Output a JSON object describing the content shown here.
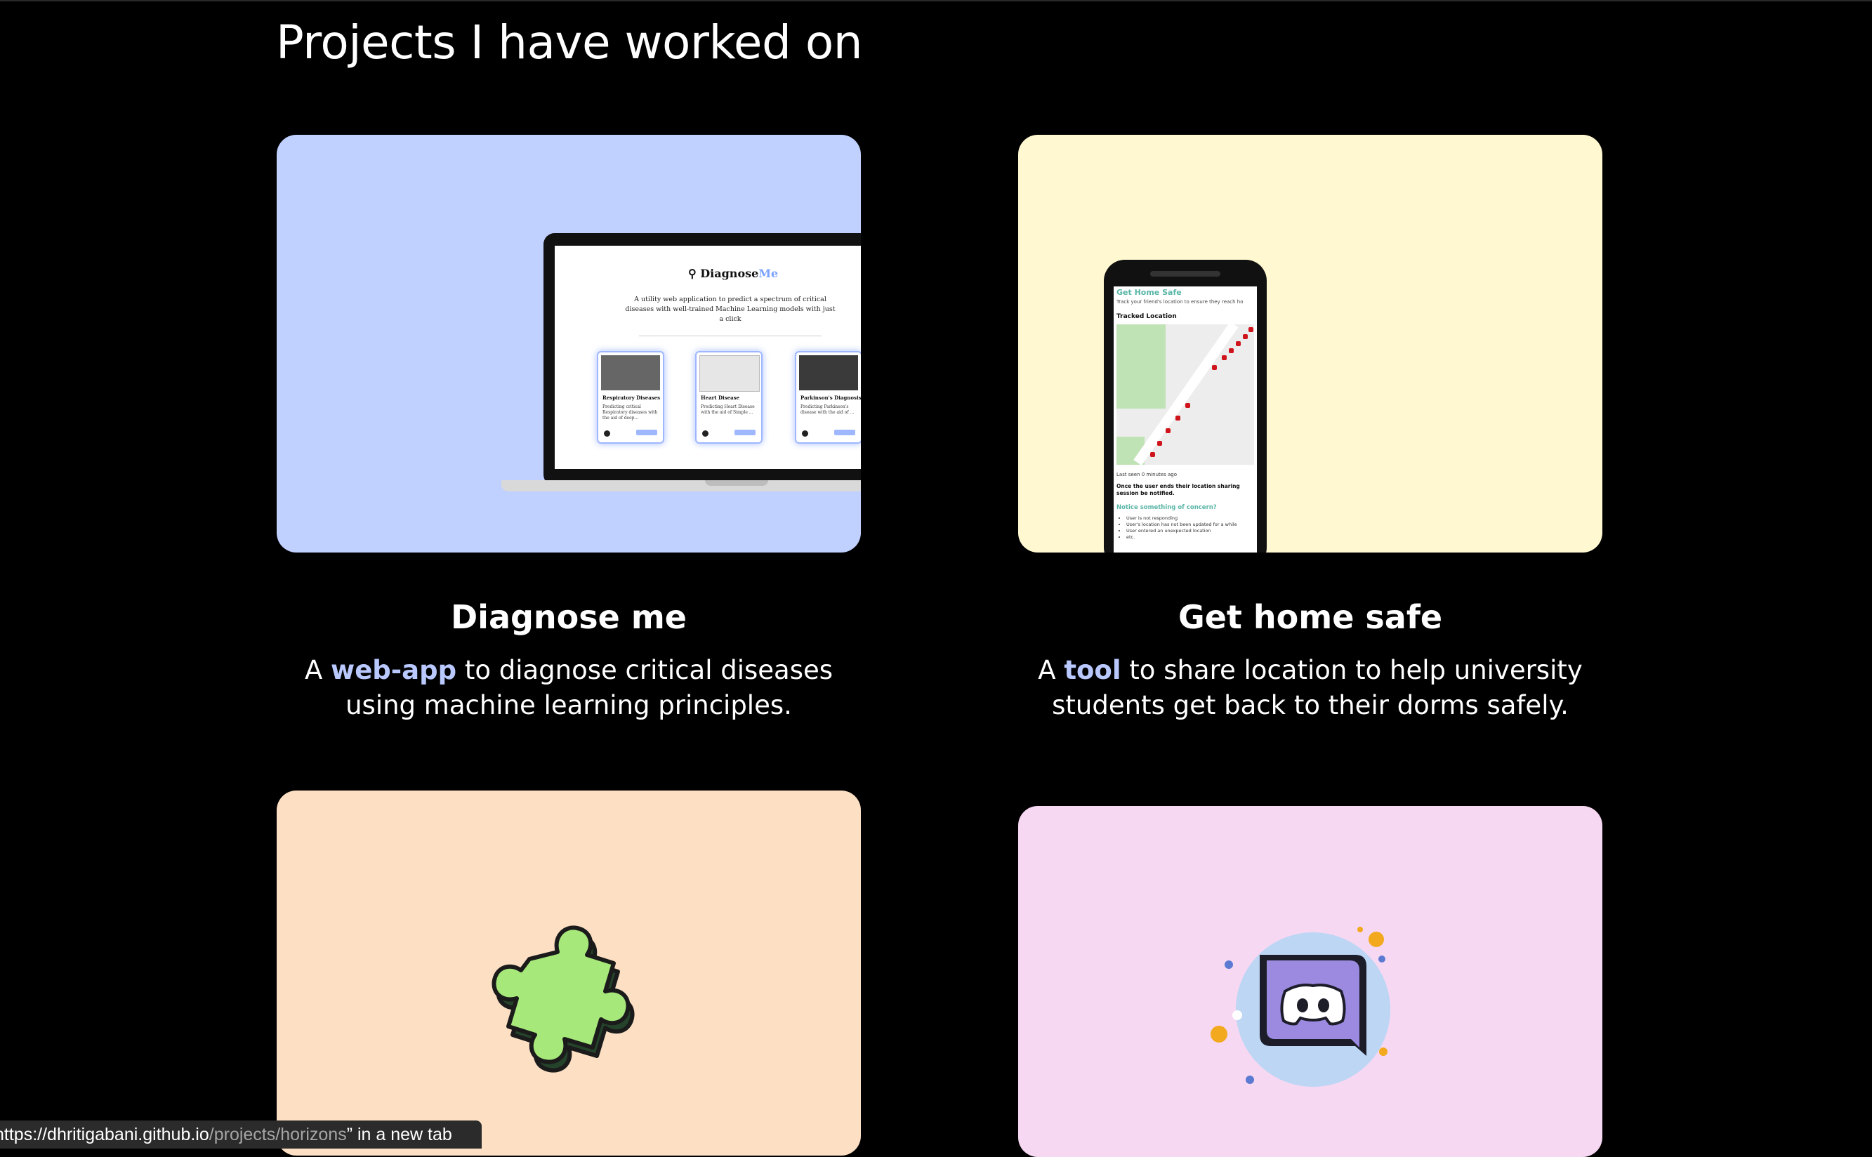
{
  "section": {
    "title": "Projects I have worked on"
  },
  "projects": [
    {
      "title": "Diagnose me",
      "desc_before": "A ",
      "highlight": "web-app",
      "desc_after": " to diagnose critical diseases using machine learning principles.",
      "bg_color": "#c0d0ff",
      "mock": {
        "logo": "Diagnose",
        "logo_accent": "Me",
        "subtitle": "A utility web application to predict a spectrum of critical diseases with well-trained Machine Learning models with just a click",
        "cards": [
          {
            "title": "Respiratory Diseases",
            "desc": "Predicting critical Respiratory diseases with the aid of deep..."
          },
          {
            "title": "Heart Disease",
            "desc": "Predicting Heart Disease with the aid of Simple ..."
          },
          {
            "title": "Parkinson's Diagnosis",
            "desc": "Predicting Parkinson's disease with the aid of ..."
          }
        ]
      }
    },
    {
      "title": "Get home safe",
      "desc_before": "A ",
      "highlight": "tool",
      "desc_after": " to share location to help university students get back to their dorms safely.",
      "bg_color": "#fff8d1",
      "mock": {
        "app_title": "Get Home Safe",
        "app_sub": "Track your friend's location to ensure they reach ho",
        "tracked": "Tracked Location",
        "last_seen": "Last seen 0 minutes ago",
        "notice_bold": "Once the user ends their location sharing session be notified.",
        "notice_title": "Notice something of concern?",
        "notice_items": [
          "User is not responding",
          "User's location has not been updated for a while",
          "User entered an unexpected location",
          "etc."
        ]
      }
    },
    {
      "bg_color": "#fde0c4",
      "icon": "puzzle-piece-icon"
    },
    {
      "bg_color": "#f7d8f3",
      "icon": "discord-icon"
    }
  ],
  "status_bar": {
    "prefix": "https://dhritigabani.github.io",
    "path": "/projects/horizons",
    "suffix": "” in a new tab"
  }
}
